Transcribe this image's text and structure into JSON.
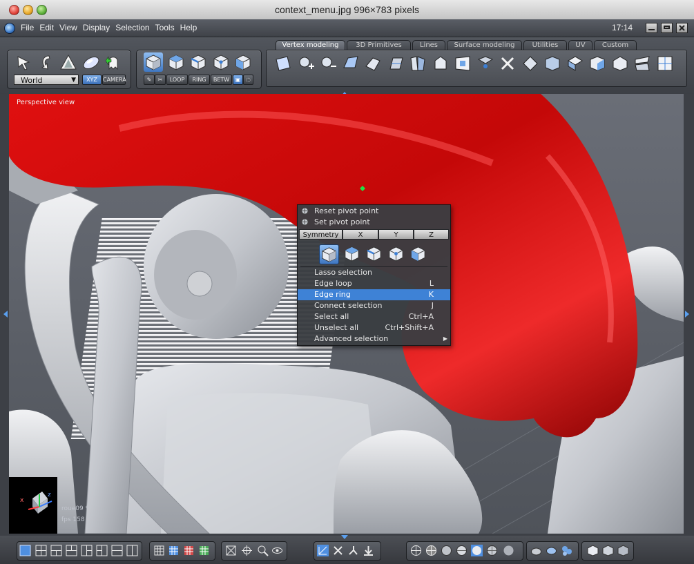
{
  "window": {
    "title": "context_menu.jpg 996×783 pixels"
  },
  "menubar": {
    "items": [
      "File",
      "Edit",
      "View",
      "Display",
      "Selection",
      "Tools",
      "Help"
    ],
    "clock": "17:14"
  },
  "toolbar": {
    "space_select": "World",
    "xyz_label": "XYZ",
    "camera_label": "CAMERA",
    "loop_label": "LOOP",
    "ring_label": "RING",
    "betw_label": "BETW",
    "tabs": [
      "Vertex modeling",
      "3D Primitives",
      "Lines",
      "Surface modeling",
      "Utilities",
      "UV",
      "Custom"
    ],
    "active_tab": "Vertex modeling"
  },
  "viewport": {
    "label": "Perspective view",
    "object_name": "roue09 *",
    "fps": "fps 158",
    "axis_labels": [
      "x",
      "z"
    ]
  },
  "context_menu": {
    "pivot_items": [
      "Reset pivot point",
      "Set pivot point"
    ],
    "symmetry": {
      "label": "Symmetry",
      "axes": [
        "X",
        "Y",
        "Z"
      ]
    },
    "selection_items": [
      {
        "label": "Lasso selection",
        "shortcut": ""
      },
      {
        "label": "Edge loop",
        "shortcut": "L"
      },
      {
        "label": "Edge ring",
        "shortcut": "K"
      },
      {
        "label": "Connect selection",
        "shortcut": "J"
      },
      {
        "label": "Select all",
        "shortcut": "Ctrl+A"
      },
      {
        "label": "Unselect all",
        "shortcut": "Ctrl+Shift+A"
      },
      {
        "label": "Advanced selection",
        "shortcut": ""
      }
    ],
    "highlighted": "Edge ring"
  },
  "colors": {
    "highlight": "#3e82d6",
    "model_red": "#c40808",
    "model_grey": "#c8cbd0",
    "ui_dark": "#3d4046"
  }
}
